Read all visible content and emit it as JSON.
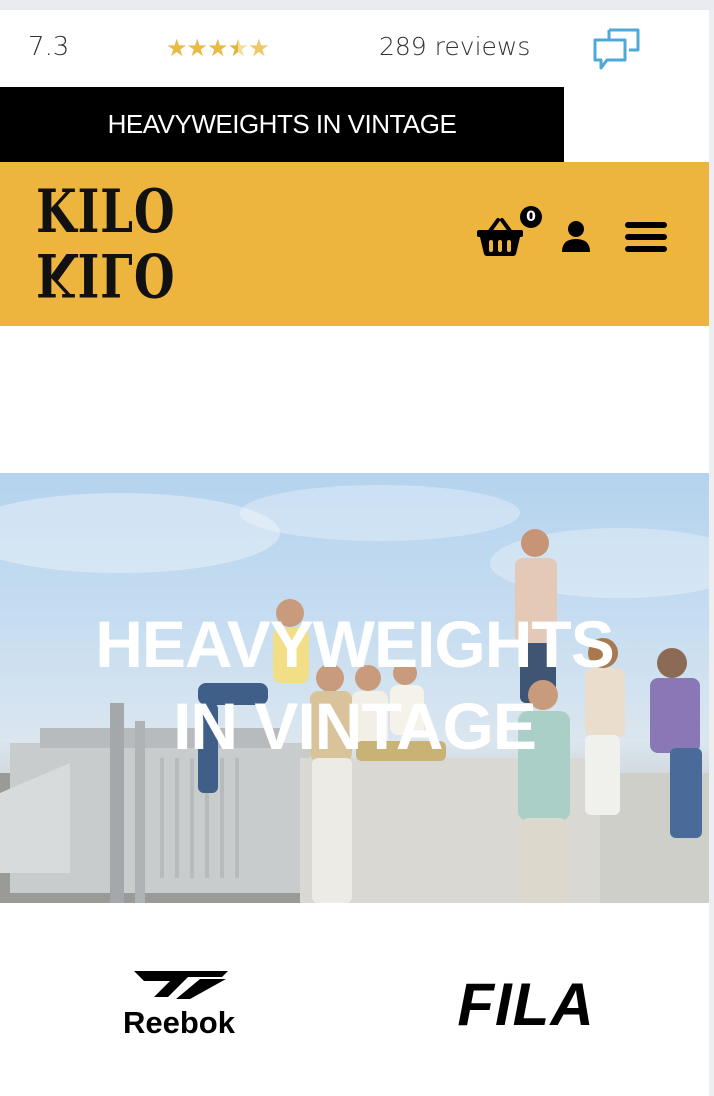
{
  "reviews": {
    "score": "7.3",
    "stars_rating": 3.5,
    "stars_glyphs": "★★★",
    "star_half": "★",
    "star_empty": "★",
    "count_text": "289 reviews",
    "icon": "chat-bubbles-icon"
  },
  "banner": {
    "text": "HEAVYWEIGHTS IN VINTAGE"
  },
  "header": {
    "logo_line1": "KILO",
    "logo_line2": "KILO",
    "cart_count": "0",
    "icons": [
      "basket-icon",
      "user-icon",
      "hamburger-menu-icon"
    ]
  },
  "hero": {
    "title_line1": "HEAVYWEIGHTS",
    "title_line2": "IN VINTAGE"
  },
  "brands": [
    {
      "name": "Reebok",
      "icon": "reebok-logo"
    },
    {
      "name": "FILA",
      "icon": "fila-logo"
    }
  ],
  "colors": {
    "header_bg": "#edb43e",
    "banner_bg": "#000000",
    "star": "#e9bb46",
    "chat_icon": "#4ea8d8"
  }
}
